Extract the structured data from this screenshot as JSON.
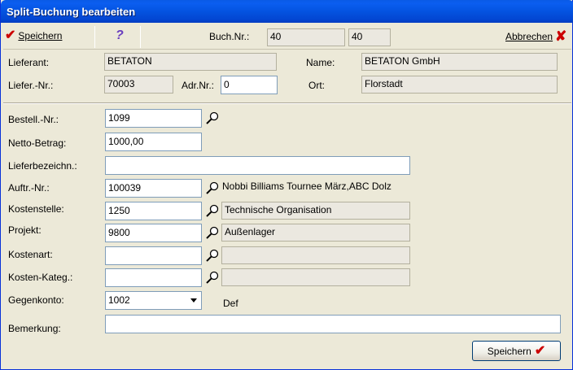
{
  "window": {
    "title": "Split-Buchung bearbeiten"
  },
  "toolbar": {
    "save_label": "Speichern",
    "help_icon": "question-mark-icon",
    "buch_nr_label": "Buch.Nr.:",
    "buch_nr_value1": "40",
    "buch_nr_value2": "40",
    "cancel_label": "Abbrechen"
  },
  "header": {
    "lieferant_label": "Lieferant:",
    "lieferant_value": "BETATON",
    "name_label": "Name:",
    "name_value": "BETATON GmbH",
    "liefer_nr_label": "Liefer.-Nr.:",
    "liefer_nr_value": "70003",
    "adr_nr_label": "Adr.Nr.:",
    "adr_nr_value": "0",
    "ort_label": "Ort:",
    "ort_value": "Florstadt"
  },
  "form": {
    "bestell_nr_label": "Bestell.-Nr.:",
    "bestell_nr_value": "1099",
    "netto_label": "Netto-Betrag:",
    "netto_value": "1000,00",
    "lieferbez_label": "Lieferbezeichn.:",
    "lieferbez_value": "",
    "auftr_nr_label": "Auftr.-Nr.:",
    "auftr_nr_value": "100039",
    "auftr_desc": "Nobbi Billiams Tournee März,ABC Dolz",
    "kostenstelle_label": "Kostenstelle:",
    "kostenstelle_value": "1250",
    "kostenstelle_desc": "Technische Organisation",
    "projekt_label": "Projekt:",
    "projekt_value": "9800",
    "projekt_desc": "Außenlager",
    "kostenart_label": "Kostenart:",
    "kostenart_value": "",
    "kostenart_desc": "",
    "kosten_kateg_label": "Kosten-Kateg.:",
    "kosten_kateg_value": "",
    "kosten_kateg_desc": "",
    "gegenkonto_label": "Gegenkonto:",
    "gegenkonto_value": "1002",
    "gegenkonto_desc": "Def",
    "bemerkung_label": "Bemerkung:",
    "bemerkung_value": ""
  },
  "footer": {
    "save_label": "Speichern"
  }
}
